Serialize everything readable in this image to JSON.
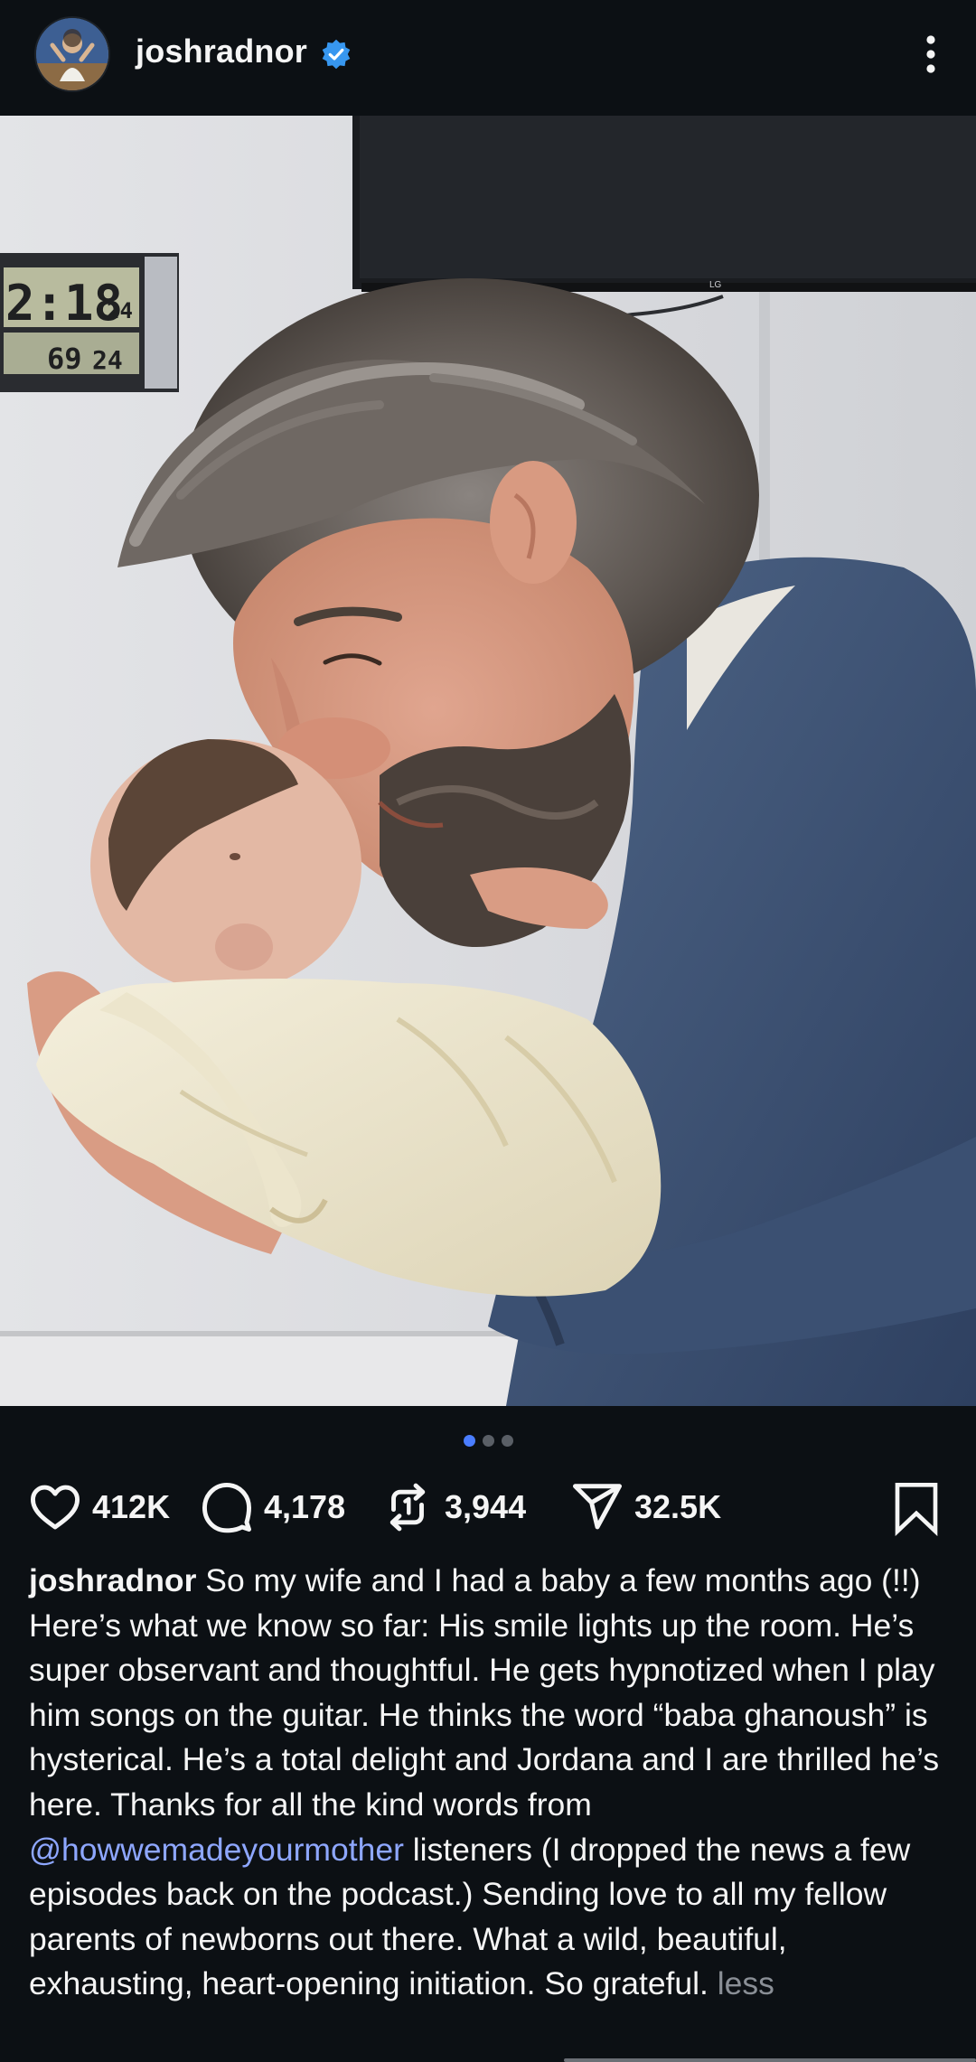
{
  "header": {
    "username": "joshradnor",
    "verified_icon": "verified-badge-icon",
    "more_icon": "more-vertical-icon"
  },
  "post": {
    "image_alt": "Man with gray beard smiling nose-to-nose with newborn baby wrapped in cream muslin blanket",
    "clock_display": {
      "time": "2:18",
      "seconds": "24",
      "temperature": "69",
      "humidity": "24"
    },
    "carousel": {
      "total": 3,
      "active_index": 0
    }
  },
  "actions": {
    "likes": "412K",
    "comments": "4,178",
    "reposts": "3,944",
    "shares": "32.5K"
  },
  "caption": {
    "username": "joshradnor",
    "text_before_mention": " So my wife and I had a baby a few months ago (!!) Here’s what we know so far: His smile lights up the room. He’s super observant and thoughtful. He gets hypnotized when I play him songs on the guitar. He thinks the word “baba ghanoush” is hysterical. He’s a total delight and Jordana and I are thrilled he’s here. Thanks for all the kind words from ",
    "mention": "@howwemadeyourmother",
    "text_after_mention": " listeners (I dropped the news a few episodes back on the podcast.) Sending love to all my fellow parents of newborns out there. What a wild, beautiful, exhausting, heart-opening initiation. So grateful. ",
    "less_label": "less"
  },
  "colors": {
    "background": "#0c1014",
    "text": "#f5f5f5",
    "mention": "#8ea7ff",
    "muted": "#8a8f96",
    "verified": "#3797f0",
    "dot_active": "#4a7dff"
  }
}
